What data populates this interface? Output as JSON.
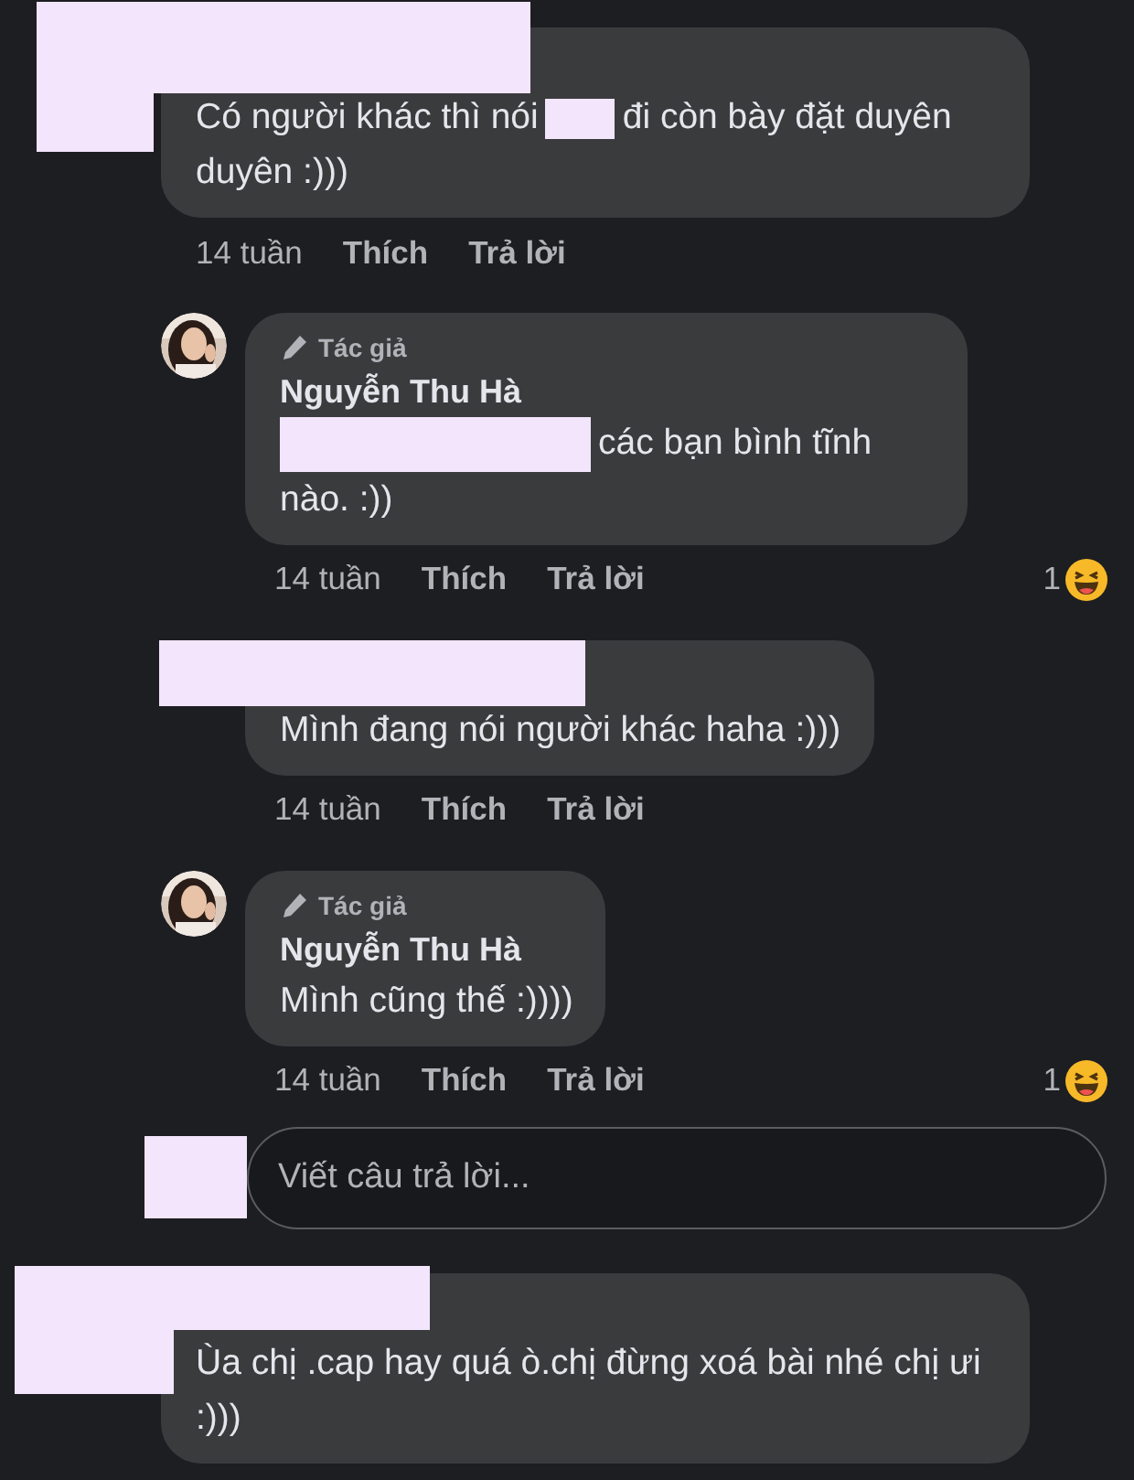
{
  "comments": [
    {
      "author": {
        "kind": "redacted"
      },
      "segments": [
        {
          "kind": "text",
          "text": "Có người khác thì nói"
        },
        {
          "kind": "redacted"
        },
        {
          "kind": "text",
          "text": "đi còn bày đặt duyên duyên :)))"
        }
      ],
      "time": "14 tuần",
      "like": "Thích",
      "reply": "Trả lời",
      "replies": [
        {
          "author": {
            "kind": "author",
            "badge": "Tác giả",
            "name": "Nguyễn Thu Hà"
          },
          "segments": [
            {
              "kind": "redacted"
            },
            {
              "kind": "text",
              "text": "các bạn bình tĩnh nào. :))"
            }
          ],
          "time": "14 tuần",
          "like": "Thích",
          "reply": "Trả lời",
          "reaction": {
            "count": "1"
          }
        },
        {
          "author": {
            "kind": "redacted"
          },
          "segments": [
            {
              "kind": "text",
              "text": "Mình đang nói người khác haha :)))"
            }
          ],
          "time": "14 tuần",
          "like": "Thích",
          "reply": "Trả lời"
        },
        {
          "author": {
            "kind": "author",
            "badge": "Tác giả",
            "name": "Nguyễn Thu Hà"
          },
          "segments": [
            {
              "kind": "text",
              "text": "Mình cũng thế :))))"
            }
          ],
          "time": "14 tuần",
          "like": "Thích",
          "reply": "Trả lời",
          "reaction": {
            "count": "1"
          }
        }
      ],
      "reply_field": {
        "placeholder": "Viết câu trả lời..."
      }
    },
    {
      "author": {
        "kind": "redacted"
      },
      "segments": [
        {
          "kind": "text",
          "text": "Ùa chị .cap hay quá ò.chị đừng xoá bài nhé chị ưi :)))"
        }
      ]
    }
  ]
}
